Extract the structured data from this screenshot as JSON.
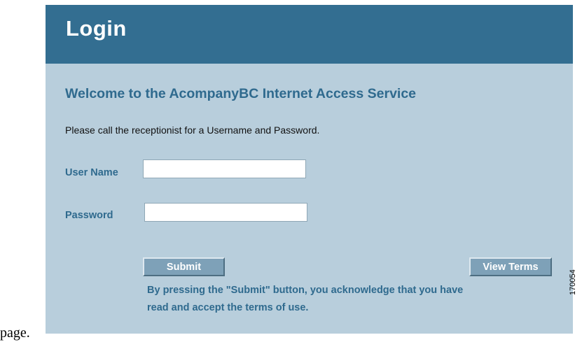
{
  "page_fragment": "page.",
  "header": {
    "title": "Login"
  },
  "welcome_text": "Welcome to the AcompanyBC Internet Access Service",
  "instructions_text": "Please call the receptionist for a Username and Password.",
  "form": {
    "username_label": "User Name",
    "username_value": "",
    "password_label": "Password",
    "password_value": ""
  },
  "buttons": {
    "submit_label": "Submit",
    "view_terms_label": "View Terms"
  },
  "terms_notice": "By pressing  the \"Submit\" button, you acknowledge that you have read and accept the terms of use.",
  "figure_id": "170054",
  "colors": {
    "header_bg": "#336e91",
    "panel_bg": "#b8cedc",
    "accent_text": "#2f6a8e",
    "button_bg": "#7ea1b8"
  }
}
